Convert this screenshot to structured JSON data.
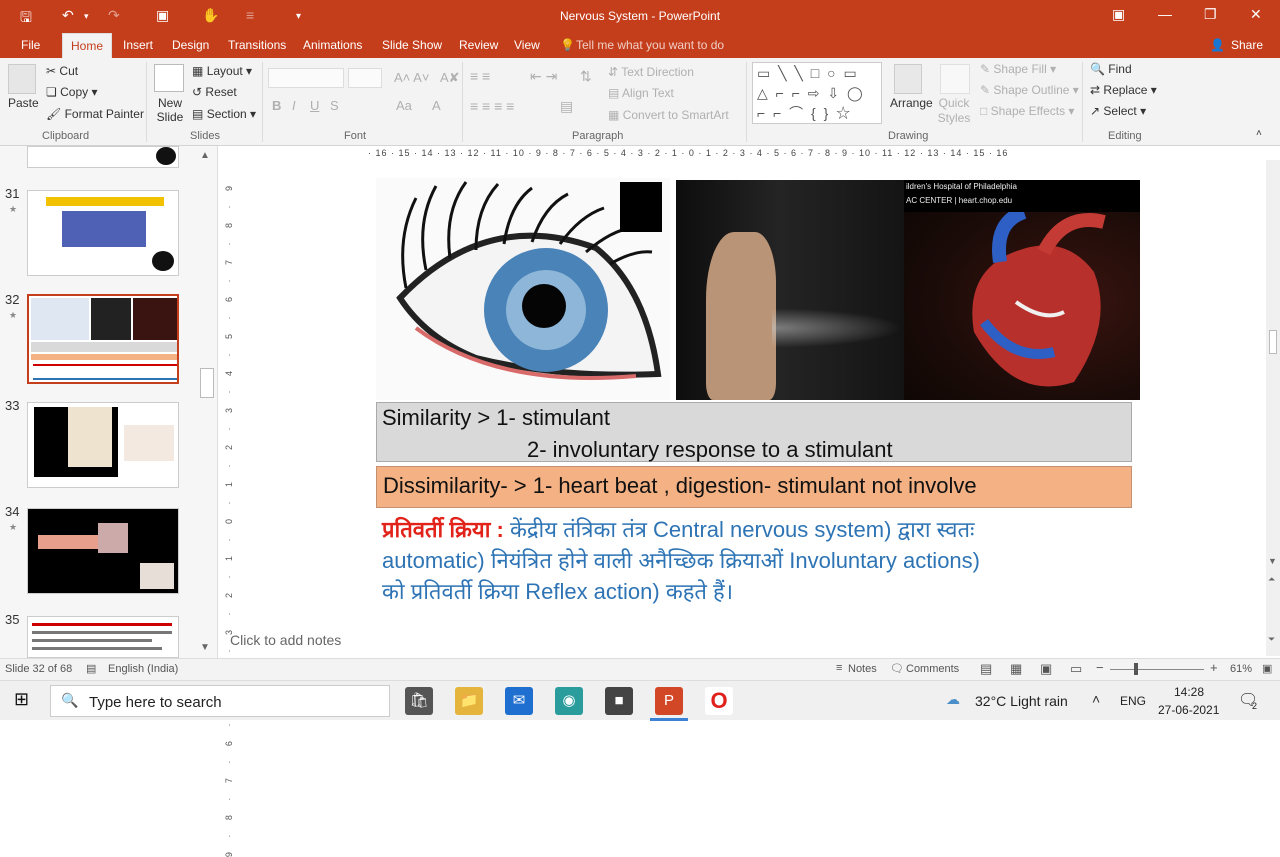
{
  "window": {
    "title": "Nervous System - PowerPoint"
  },
  "quick_access": {
    "save_icon": "save-icon",
    "undo_icon": "undo-icon",
    "redo_icon": "redo-icon"
  },
  "tabs": [
    "File",
    "Home",
    "Insert",
    "Design",
    "Transitions",
    "Animations",
    "Slide Show",
    "Review",
    "View"
  ],
  "tell_me": "Tell me what you want to do",
  "share": "Share",
  "ribbon": {
    "clipboard": {
      "paste": "Paste",
      "cut": "Cut",
      "copy": "Copy",
      "format_painter": "Format Painter",
      "label": "Clipboard"
    },
    "slides": {
      "new_slide": "New Slide",
      "layout": "Layout",
      "reset": "Reset",
      "section": "Section",
      "label": "Slides"
    },
    "font": {
      "label": "Font",
      "bold": "B",
      "italic": "I",
      "underline": "U",
      "strike": "S"
    },
    "paragraph": {
      "label": "Paragraph",
      "text_direction": "Text Direction",
      "align_text": "Align Text",
      "smartart": "Convert to SmartArt"
    },
    "drawing": {
      "label": "Drawing",
      "arrange": "Arrange",
      "quick_styles": "Quick Styles",
      "shape_fill": "Shape Fill",
      "shape_outline": "Shape Outline",
      "shape_effects": "Shape Effects"
    },
    "editing": {
      "label": "Editing",
      "find": "Find",
      "replace": "Replace",
      "select": "Select"
    }
  },
  "ruler": {
    "top": "· 16 · 15 · 14 · 13 · 12 · 11 · 10 · 9 · 8 · 7 · 6 · 5 · 4 · 3 · 2 · 1 · 0 · 1 · 2 · 3 · 4 · 5 · 6 · 7 · 8 · 9 · 10 · 11 · 12 · 13 · 14 · 15 · 16",
    "left": "9 · 8 · 7 · 6 · 5 · 4 · 3 · 2 · 1 · 0 · 1 · 2 · 3 · 4 · 5 · 6 · 7 · 8 · 9"
  },
  "thumbnails": [
    {
      "num": "31"
    },
    {
      "num": "32",
      "selected": true
    },
    {
      "num": "33"
    },
    {
      "num": "34"
    },
    {
      "num": "35"
    }
  ],
  "slide": {
    "heart_caption_1": "ildren's Hospital of Philadelphia",
    "heart_caption_2": "AC CENTER  |  heart.chop.edu",
    "sim_line1": "Similarity  >  1- stimulant",
    "sim_line2": "2- involuntary response to a stimulant",
    "dis_line": "Dissimilarity- >  1- heart beat , digestion- stimulant not involve",
    "hindi_label": "प्रतिवर्ती क्रिया :",
    "hindi_line1": " केंद्रीय तंत्रिका तंत्र    Central nervous system) द्वारा स्वतः",
    "hindi_line2": "automatic) नियंत्रित होने वाली अनैच्छिक क्रियाओं Involuntary actions)",
    "hindi_line3": "को प्रतिवर्ती क्रिया Reflex action) कहते हैं।"
  },
  "notes_placeholder": "Click to add notes",
  "status": {
    "slide_info": "Slide 32 of 68",
    "language": "English (India)",
    "notes": "Notes",
    "comments": "Comments",
    "zoom": "61%"
  },
  "taskbar": {
    "search_placeholder": "Type here to search",
    "weather": "32°C  Light rain",
    "lang": "ENG",
    "time": "14:28",
    "date": "27-06-2021",
    "notif_count": "2"
  }
}
